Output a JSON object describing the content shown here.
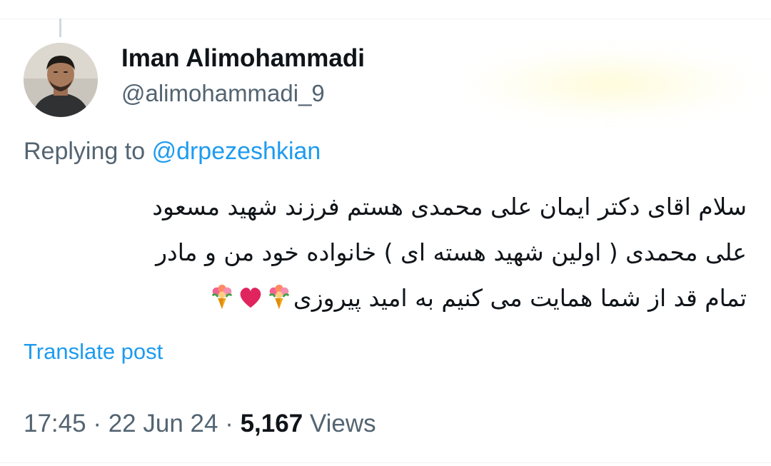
{
  "tweet": {
    "author": {
      "display_name": "Iman Alimohammadi",
      "handle": "@alimohammadi_9",
      "avatar_icon": "user-avatar-photo"
    },
    "replying_to": {
      "prefix": "Replying to",
      "mention": "@drpezeshkian"
    },
    "text_lines": [
      "سلام اقای دکتر ایمان علی محمدی هستم فرزند شهید مسعود",
      "علی محمدی ( اولین شهید هسته ای ) خانواده خود من و مادر",
      "تمام قد از شما همایت می کنیم به امید پیروزی"
    ],
    "emojis": [
      "bouquet-icon",
      "red-heart-icon",
      "bouquet-icon"
    ],
    "translate_label": "Translate post",
    "meta": {
      "time": "17:45",
      "separator": "·",
      "date": "22 Jun 24",
      "views_count": "5,167",
      "views_label": "Views"
    }
  },
  "colors": {
    "primary_text": "#0f1419",
    "secondary_text": "#536471",
    "accent": "#1d9bf0",
    "heart": "#e0245e"
  }
}
